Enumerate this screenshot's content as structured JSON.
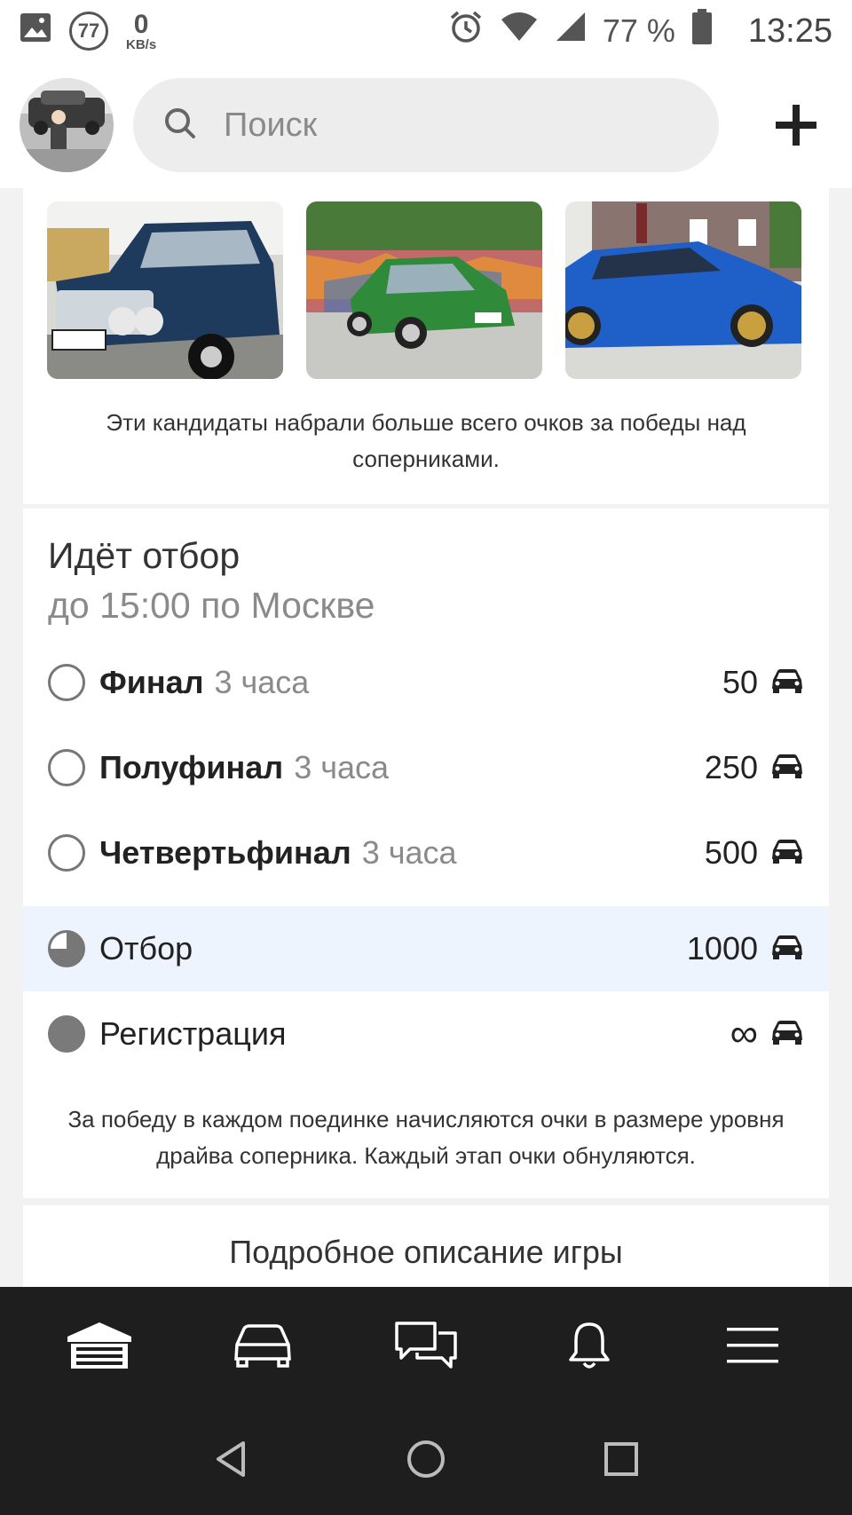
{
  "status_bar": {
    "notification_count": "77",
    "speed_value": "0",
    "speed_unit": "KB/s",
    "battery_percent": "77 %",
    "time": "13:25",
    "icons": [
      "image-icon",
      "alarm-icon",
      "wifi-icon",
      "signal-icon",
      "battery-icon"
    ]
  },
  "header": {
    "search_placeholder": "Поиск",
    "icons": [
      "avatar",
      "search-icon",
      "plus-icon"
    ]
  },
  "winners": {
    "note": "Эти кандидаты набрали больше всего очков за победы над соперниками."
  },
  "selection": {
    "title": "Идёт отбор",
    "subtitle": "до 15:00 по Москве",
    "stages": [
      {
        "name": "Финал",
        "duration": "3 часа",
        "points": "50",
        "status": "pending"
      },
      {
        "name": "Полуфинал",
        "duration": "3 часа",
        "points": "250",
        "status": "pending"
      },
      {
        "name": "Четвертьфинал",
        "duration": "3 часа",
        "points": "500",
        "status": "pending"
      },
      {
        "name": "Отбор",
        "duration": "",
        "points": "1000",
        "status": "active",
        "progress": 0.75
      },
      {
        "name": "Регистрация",
        "duration": "",
        "points": "∞",
        "status": "done"
      }
    ],
    "rules_note": "За победу в каждом поединке начисляются очки в размере уровня драйва соперника. Каждый этап очки обнуляются.",
    "more_link": "Подробное описание игры"
  },
  "tabbar": {
    "items": [
      "garage-icon",
      "car-icon",
      "chat-icon",
      "bell-icon",
      "menu-icon"
    ]
  },
  "android_nav": {
    "items": [
      "back-icon",
      "home-icon",
      "recents-icon"
    ]
  },
  "colors": {
    "active_row": "#eef4fd",
    "tabbar_bg": "#1e1e1e",
    "muted_text": "#8a8a8a"
  }
}
